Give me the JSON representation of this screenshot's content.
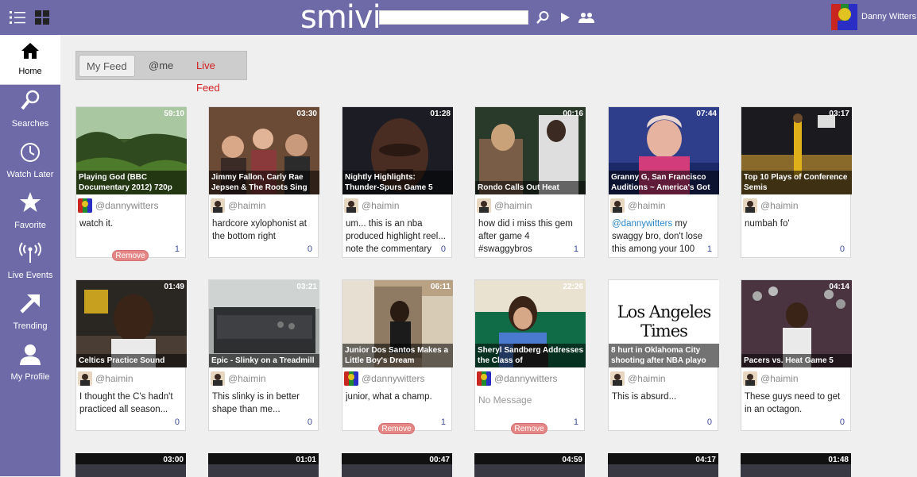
{
  "app": {
    "logo": "smivi",
    "search": {
      "value": "",
      "placeholder": ""
    },
    "user_name": "Danny Witters"
  },
  "icons": {
    "menu": "list-view-icon",
    "grid": "grid-view-icon",
    "search": "search-icon",
    "play": "play-icon",
    "people": "people-icon"
  },
  "sidebar": {
    "items": [
      {
        "label": "Home",
        "icon": "home-icon",
        "active": true
      },
      {
        "label": "Searches",
        "icon": "magnifier-icon"
      },
      {
        "label": "Watch Later",
        "icon": "clock-icon"
      },
      {
        "label": "Favorite",
        "icon": "star-icon"
      },
      {
        "label": "Live Events",
        "icon": "antenna-icon"
      },
      {
        "label": "Trending",
        "icon": "arrow-up-right-icon"
      },
      {
        "label": "My Profile",
        "icon": "person-icon"
      }
    ]
  },
  "tabs": [
    {
      "label": "My Feed",
      "active": true
    },
    {
      "label": "@me"
    },
    {
      "label": "Live Feed"
    }
  ],
  "colors": {
    "brand": "#6e6aa8",
    "live": "#d21e1e",
    "mention": "#2b86c6",
    "count": "#3c4c9a",
    "remove": "#e58787"
  },
  "cards": [
    {
      "duration": "59:10",
      "title": "Playing God (BBC Documentary 2012) 720p",
      "user": "@dannywitters",
      "message": "watch it.",
      "count": "1",
      "remove": "Remove"
    },
    {
      "duration": "03:30",
      "title": "Jimmy Fallon, Carly Rae Jepsen & The Roots Sing",
      "user": "@haimin",
      "message": "hardcore xylophonist at the bottom right",
      "count": "0"
    },
    {
      "duration": "01:28",
      "title": "Nightly Highlights: Thunder-Spurs Game 5",
      "user": "@haimin",
      "message": "um... this is an nba produced highlight reel... note the commentary",
      "count": "0"
    },
    {
      "duration": "00:16",
      "title": "Rondo Calls Out Heat",
      "user": "@haimin",
      "message": "how did i miss this gem after game 4 #swaggybros",
      "count": "1"
    },
    {
      "duration": "07:44",
      "title": "Granny G, San Francisco Auditions ~ America's Got",
      "user": "@haimin",
      "mention": "@dannywitters",
      "message": " my swaggy bro, don't lose this among your 100",
      "count": "1"
    },
    {
      "duration": "03:17",
      "title": "Top 10 Plays of Conference Semis",
      "user": "@haimin",
      "message": "numbah fo'",
      "count": "0"
    },
    {
      "duration": "01:49",
      "title": "Celtics Practice Sound",
      "user": "@haimin",
      "message": "I thought the C's hadn't practiced all season...",
      "count": "0"
    },
    {
      "duration": "03:21",
      "title": "Epic - Slinky on a Treadmill",
      "user": "@haimin",
      "message": "This slinky is in better shape than me...",
      "count": "0"
    },
    {
      "duration": "06:11",
      "title": "Junior Dos Santos Makes a Little Boy's Dream",
      "user": "@dannywitters",
      "message": "junior, what a champ.",
      "count": "1",
      "remove": "Remove"
    },
    {
      "duration": "22:26",
      "title": "Sheryl Sandberg Addresses the Class of",
      "user": "@dannywitters",
      "message": "No Message",
      "empty": true,
      "count": "1",
      "remove": "Remove"
    },
    {
      "duration": "",
      "title": "8 hurt in Oklahoma City shooting after NBA playo",
      "user": "@haimin",
      "message": "This is absurd...",
      "count": "0",
      "thumb_text": "Los Angeles Times"
    },
    {
      "duration": "04:14",
      "title": "Pacers vs. Heat Game 5",
      "user": "@haimin",
      "message": "These guys need to get in an octagon.",
      "count": "0"
    }
  ],
  "partial_cards": [
    {
      "duration": "03:00"
    },
    {
      "duration": "01:01"
    },
    {
      "duration": "00:47"
    },
    {
      "duration": "04:59"
    },
    {
      "duration": "04:17"
    },
    {
      "duration": "01:48"
    }
  ]
}
